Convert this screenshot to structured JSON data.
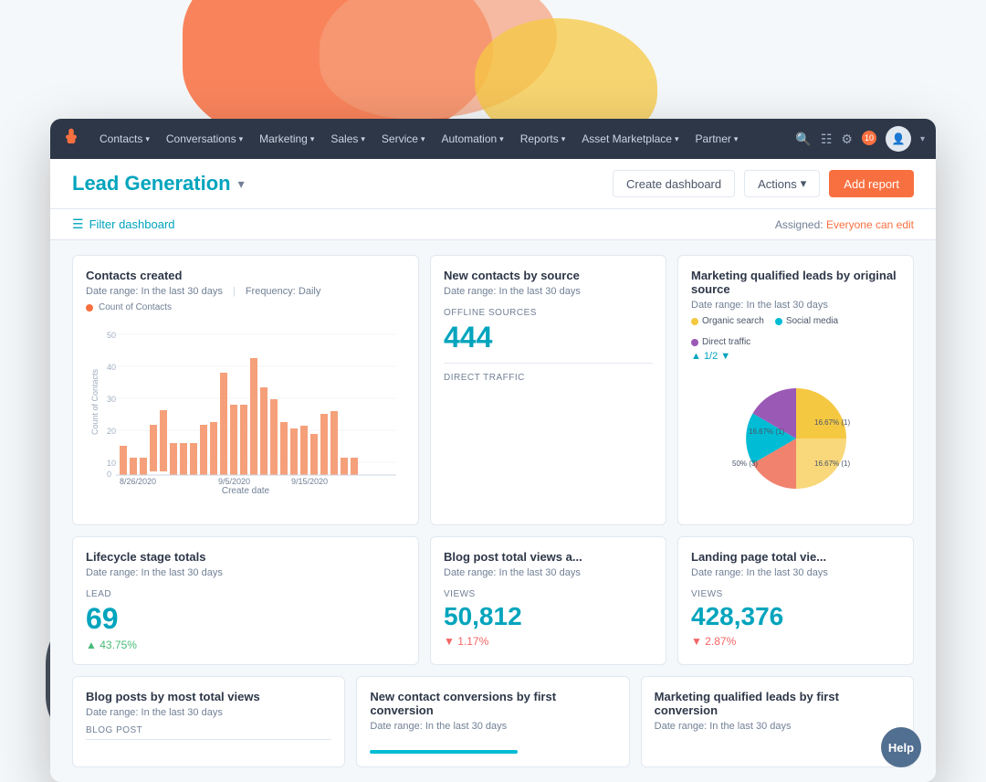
{
  "blobs": {},
  "nav": {
    "logo": "H",
    "items": [
      {
        "label": "Contacts",
        "id": "contacts"
      },
      {
        "label": "Conversations",
        "id": "conversations"
      },
      {
        "label": "Marketing",
        "id": "marketing"
      },
      {
        "label": "Sales",
        "id": "sales"
      },
      {
        "label": "Service",
        "id": "service"
      },
      {
        "label": "Automation",
        "id": "automation"
      },
      {
        "label": "Reports",
        "id": "reports"
      },
      {
        "label": "Asset Marketplace",
        "id": "asset-marketplace"
      },
      {
        "label": "Partner",
        "id": "partner"
      }
    ],
    "notification_count": "10"
  },
  "header": {
    "title": "Lead Generation",
    "dropdown_icon": "▾",
    "create_dashboard_label": "Create dashboard",
    "actions_label": "Actions",
    "actions_chevron": "▾",
    "add_report_label": "Add report"
  },
  "sub_header": {
    "filter_label": "Filter dashboard",
    "assigned_label": "Assigned:",
    "assigned_value": "Everyone can edit"
  },
  "cards": {
    "contacts_created": {
      "title": "Contacts created",
      "date_range": "Date range: In the last 30 days",
      "frequency": "Frequency: Daily",
      "legend_label": "Count of Contacts",
      "x_axis_label": "Create date",
      "y_axis_label": "Count of Contacts",
      "dates": [
        "8/26/2020",
        "9/5/2020",
        "9/15/2020"
      ],
      "bars": [
        {
          "date": "8/26",
          "value": 10,
          "label": "10"
        },
        {
          "date": "",
          "value": 6,
          "label": "6"
        },
        {
          "date": "",
          "value": 6,
          "label": "6"
        },
        {
          "date": "",
          "value": 16,
          "label": "16"
        },
        {
          "date": "",
          "value": 21,
          "label": "21"
        },
        {
          "date": "",
          "value": 11,
          "label": "11"
        },
        {
          "date": "",
          "value": 11,
          "label": "11"
        },
        {
          "date": "",
          "value": 11,
          "label": "11"
        },
        {
          "date": "",
          "value": 17,
          "label": "17"
        },
        {
          "date": "",
          "value": 18,
          "label": "18"
        },
        {
          "date": "9/5",
          "value": 35,
          "label": "35"
        },
        {
          "date": "",
          "value": 24,
          "label": "24"
        },
        {
          "date": "",
          "value": 24,
          "label": "24"
        },
        {
          "date": "",
          "value": 40,
          "label": "40"
        },
        {
          "date": "",
          "value": 30,
          "label": "30"
        },
        {
          "date": "",
          "value": 26,
          "label": "26"
        },
        {
          "date": "9/15",
          "value": 18,
          "label": "18"
        },
        {
          "date": "",
          "value": 16,
          "label": "16"
        },
        {
          "date": "",
          "value": 17,
          "label": "17"
        },
        {
          "date": "",
          "value": 14,
          "label": "14"
        },
        {
          "date": "",
          "value": 21,
          "label": "21"
        },
        {
          "date": "",
          "value": 22,
          "label": "22"
        },
        {
          "date": "",
          "value": 6,
          "label": "6"
        },
        {
          "date": "",
          "value": 6,
          "label": "6"
        },
        {
          "date": "",
          "value": 0,
          "label": "0"
        },
        {
          "date": "",
          "value": 0,
          "label": "0"
        }
      ]
    },
    "new_contacts_by_source": {
      "title": "New contacts by source",
      "date_range": "Date range: In the last 30 days",
      "stat_label": "OFFLINE SOURCES",
      "stat_value": "444",
      "stat2_label": "DIRECT TRAFFIC"
    },
    "lifecycle_stage": {
      "title": "Lifecycle stage totals",
      "date_range": "Date range: In the last 30 days",
      "stat_label": "LEAD",
      "stat_value": "69",
      "stat_change": "43.75%",
      "stat_change_dir": "up"
    },
    "mql_by_source": {
      "title": "Marketing qualified leads by original source",
      "date_range": "Date range: In the last 30 days",
      "legend": [
        {
          "label": "Organic search",
          "color": "#f5c842"
        },
        {
          "label": "Social media",
          "color": "#00bcd4"
        },
        {
          "label": "Direct traffic",
          "color": "#9b59b6"
        }
      ],
      "pagination": "▲ 1/2 ▼",
      "pie_segments": [
        {
          "label": "50% (3)",
          "color": "#f5c842",
          "percent": 50
        },
        {
          "label": "16.67% (1)",
          "color": "#f0826e",
          "percent": 16.67
        },
        {
          "label": "16.67% (1)",
          "color": "#00bcd4",
          "percent": 16.67
        },
        {
          "label": "16.67% (1)",
          "color": "#9b59b6",
          "percent": 16.67
        }
      ]
    },
    "blog_post_views": {
      "title": "Blog post total views a...",
      "date_range": "Date range: In the last 30 days",
      "stat_label": "VIEWS",
      "stat_value": "50,812",
      "stat_change": "1.17%",
      "stat_change_dir": "down"
    },
    "landing_page_views": {
      "title": "Landing page total vie...",
      "date_range": "Date range: In the last 30 days",
      "stat_label": "VIEWS",
      "stat_value": "428,376",
      "stat_change": "2.87%",
      "stat_change_dir": "down"
    },
    "blog_posts_most_views": {
      "title": "Blog posts by most total views",
      "date_range": "Date range: In the last 30 days",
      "col_label": "BLOG POST"
    },
    "new_contact_conversions": {
      "title": "New contact conversions by first conversion",
      "date_range": "Date range: In the last 30 days"
    },
    "mql_by_first_conversion": {
      "title": "Marketing qualified leads by first conversion",
      "date_range": "Date range: In the last 30 days"
    }
  },
  "help_button_label": "Help"
}
